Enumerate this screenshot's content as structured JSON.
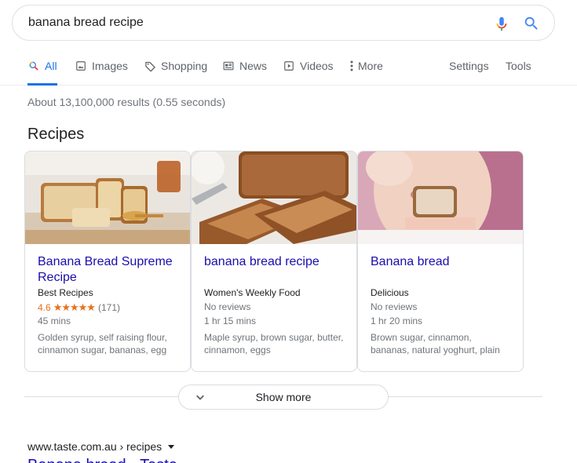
{
  "search": {
    "query": "banana bread recipe"
  },
  "tabs": [
    {
      "label": "All",
      "icon": "search-icon"
    },
    {
      "label": "Images",
      "icon": "image-icon"
    },
    {
      "label": "Shopping",
      "icon": "tag-icon"
    },
    {
      "label": "News",
      "icon": "newspaper-icon"
    },
    {
      "label": "Videos",
      "icon": "play-icon"
    },
    {
      "label": "More",
      "icon": "dots-icon"
    }
  ],
  "tools": {
    "settings": "Settings",
    "tools": "Tools"
  },
  "stats": "About 13,100,000 results (0.55 seconds)",
  "recipes": {
    "title": "Recipes",
    "cards": [
      {
        "title": "Banana Bread Supreme Recipe",
        "source": "Best Recipes",
        "rating": "4.6",
        "stars": "★★★★★",
        "reviews": "(171)",
        "time": "45 mins",
        "ingredients": "Golden syrup, self raising flour, cinnamon sugar, bananas, egg"
      },
      {
        "title": "banana bread recipe",
        "source": "Women's Weekly Food",
        "reviews_text": "No reviews",
        "time": "1 hr 15 mins",
        "ingredients": "Maple syrup, brown sugar, butter, cinnamon, eggs"
      },
      {
        "title": "Banana bread",
        "source": "Delicious",
        "reviews_text": "No reviews",
        "time": "1 hr 20 mins",
        "ingredients": "Brown sugar, cinnamon, bananas, natural yoghurt, plain"
      }
    ],
    "show_more": "Show more"
  },
  "result": {
    "cite": "www.taste.com.au › recipes",
    "title": "Banana bread - Taste"
  },
  "colors": {
    "link": "#1a0dab",
    "accent": "#1a73e8",
    "star": "#e7711b"
  }
}
